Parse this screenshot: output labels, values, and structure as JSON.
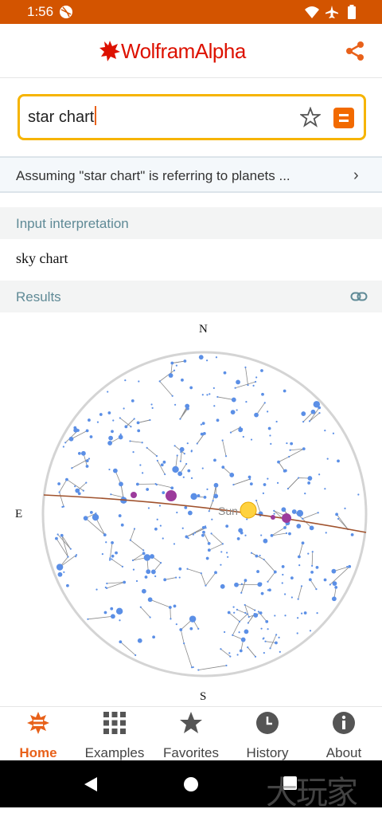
{
  "status_bar": {
    "time": "1:56"
  },
  "app": {
    "brand": "WolframAlpha"
  },
  "search": {
    "value": "star chart"
  },
  "assumption": {
    "text": "Assuming \"star chart\" is  referring to planets ..."
  },
  "input_interpretation": {
    "heading": "Input interpretation",
    "value": "sky chart"
  },
  "results": {
    "heading": "Results"
  },
  "chart_data": {
    "type": "sky chart",
    "directions": {
      "north": "N",
      "east": "E",
      "south": "S"
    },
    "labels": [
      "Sun"
    ],
    "grid": false
  },
  "bottom_nav": {
    "items": [
      {
        "label": "Home",
        "icon": "wolfram-home-icon",
        "active": true
      },
      {
        "label": "Examples",
        "icon": "grid-icon"
      },
      {
        "label": "Favorites",
        "icon": "star-icon"
      },
      {
        "label": "History",
        "icon": "clock-icon"
      },
      {
        "label": "About",
        "icon": "info-icon"
      }
    ]
  },
  "watermark": "大玩家",
  "colors": {
    "status_bar": "#d35400",
    "accent": "#e8611a",
    "search_border": "#f6b400",
    "star": "#5b8fe6",
    "planet": "#9c3b9c",
    "sun": "#ffd23f",
    "ecliptic": "#a0522d"
  }
}
